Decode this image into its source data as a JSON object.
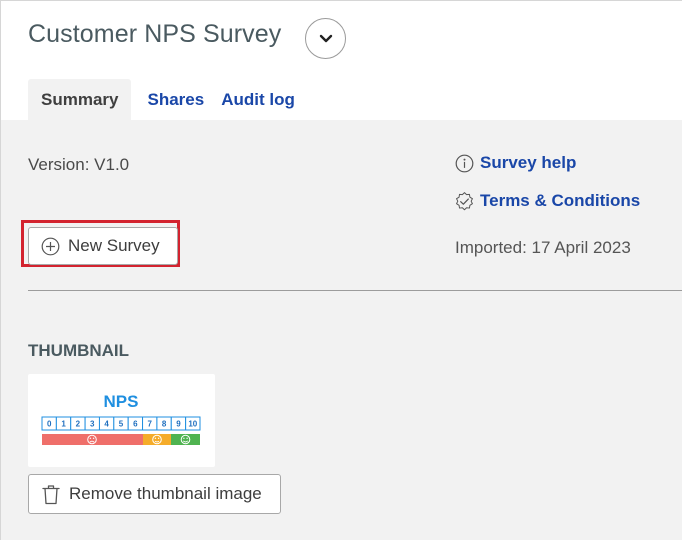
{
  "header": {
    "title": "Customer NPS Survey",
    "collapse_icon": "chevron-down-icon"
  },
  "tabs": [
    {
      "label": "Summary",
      "active": true
    },
    {
      "label": "Shares",
      "active": false
    },
    {
      "label": "Audit log",
      "active": false
    }
  ],
  "summary": {
    "version": "Version: V1.0",
    "new_survey_label": "New Survey",
    "new_survey_icon": "plus-circle-icon",
    "survey_help_label": "Survey help",
    "survey_help_icon": "info-icon",
    "terms_label": "Terms & Conditions",
    "terms_icon": "check-badge-icon",
    "imported": "Imported: 17 April 2023",
    "highlight_color": "#d3232f"
  },
  "thumbnail": {
    "heading": "THUMBNAIL",
    "image": {
      "title": "NPS",
      "scale": [
        "0",
        "1",
        "2",
        "3",
        "4",
        "5",
        "6",
        "7",
        "8",
        "9",
        "10"
      ],
      "colors": {
        "detractor": "#ef6f6a",
        "passive": "#f5ac2a",
        "promoter": "#4fb350",
        "title": "#1f8fe0"
      }
    },
    "remove_label": "Remove thumbnail image",
    "remove_icon": "trash-icon"
  },
  "colors": {
    "link": "#1a47a8",
    "panel_bg": "#f2f2f2",
    "title": "#4a5a60"
  }
}
